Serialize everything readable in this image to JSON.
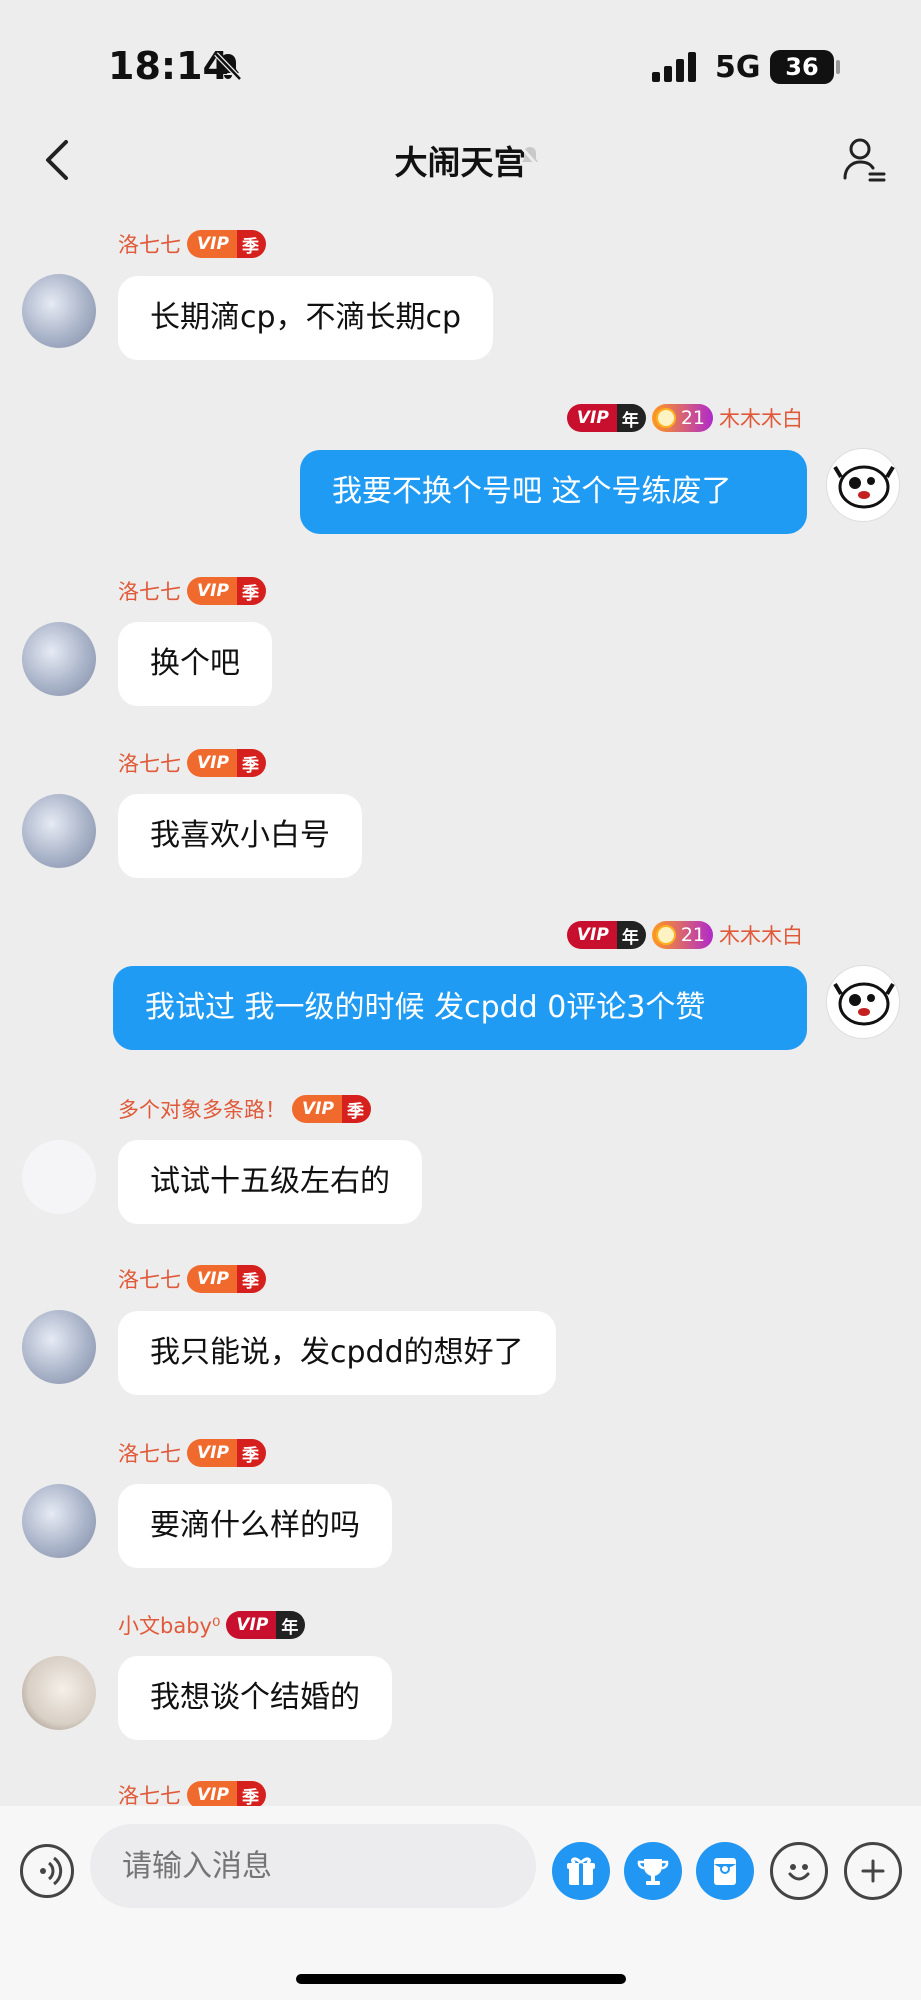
{
  "status_bar": {
    "time": "18:14",
    "network": "5G",
    "battery": "36"
  },
  "header": {
    "title": "大闹天宫"
  },
  "messages": [
    {
      "dir": "in",
      "sender": "洛七七",
      "vip_tier": "季",
      "text": "长期滴cp，不滴长期cp",
      "avatar": "girl-avatar"
    },
    {
      "dir": "out",
      "sender": "木木木白",
      "vip_tier": "年",
      "level": "21",
      "text": "我要不换个号吧 这个号练废了",
      "avatar": "dog-avatar"
    },
    {
      "dir": "in",
      "sender": "洛七七",
      "vip_tier": "季",
      "text": "换个吧",
      "avatar": "girl-avatar"
    },
    {
      "dir": "in",
      "sender": "洛七七",
      "vip_tier": "季",
      "text": "我喜欢小白号",
      "avatar": "girl-avatar"
    },
    {
      "dir": "out",
      "sender": "木木木白",
      "vip_tier": "年",
      "level": "21",
      "text": "我试过 我一级的时候 发cpdd 0评论3个赞",
      "avatar": "dog-avatar"
    },
    {
      "dir": "in",
      "sender": "多个对象多条路！",
      "vip_tier": "季",
      "text": "试试十五级左右的",
      "avatar": "blank-avatar"
    },
    {
      "dir": "in",
      "sender": "洛七七",
      "vip_tier": "季",
      "text": "我只能说，发cpdd的想好了",
      "avatar": "girl-avatar"
    },
    {
      "dir": "in",
      "sender": "洛七七",
      "vip_tier": "季",
      "text": "要滴什么样的吗",
      "avatar": "girl-avatar"
    },
    {
      "dir": "in",
      "sender": "小文baby⁰",
      "vip_tier": "年",
      "text": "我想谈个结婚的",
      "avatar": "baby-avatar"
    },
    {
      "dir": "in",
      "sender": "洛七七",
      "vip_tier": "季",
      "text": "",
      "avatar": "girl-avatar"
    }
  ],
  "vip_label": "VIP",
  "input": {
    "placeholder": "请输入消息"
  },
  "toolbar_icons": [
    "voice-icon",
    "gift-icon",
    "trophy-icon",
    "red-packet-icon",
    "emoji-icon",
    "plus-icon"
  ],
  "colors": {
    "out_bubble": "#1f9bf4",
    "in_bubble": "#ffffff",
    "background": "#ededed",
    "name": "#e05a3a"
  }
}
